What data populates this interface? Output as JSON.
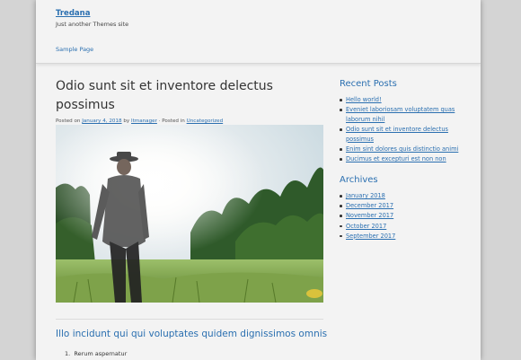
{
  "site": {
    "title": "Tredana",
    "description": "Just another Themes site",
    "nav": [
      "Sample Page"
    ]
  },
  "post": {
    "title": "Odio sunt sit et inventore delectus possimus",
    "meta": {
      "posted_on": "Posted on",
      "date": "January 4, 2018",
      "by": "by",
      "author": "ltmanager",
      "posted_in": "· Posted in",
      "category": "Uncategorized"
    },
    "image_icon": "featured-photo-man-in-field",
    "subheading": "Illo incidunt qui qui voluptates quidem dignissimos omnis",
    "list_first": "Rerum aspernatur"
  },
  "sidebar": {
    "recent_posts": {
      "title": "Recent Posts",
      "items": [
        "Hello world!",
        "Eveniet laboriosam voluptatem quas laborum nihil",
        "Odio sunt sit et inventore delectus possimus",
        "Enim sint dolores quis distinctio animi",
        "Ducimus et excepturi est non non"
      ]
    },
    "archives": {
      "title": "Archives",
      "items": [
        "January 2018",
        "December 2017",
        "November 2017",
        "October 2017",
        "September 2017"
      ]
    }
  },
  "colors": {
    "link": "#2a6fb0",
    "background": "#d4d4d4",
    "page": "#f3f3f3"
  }
}
